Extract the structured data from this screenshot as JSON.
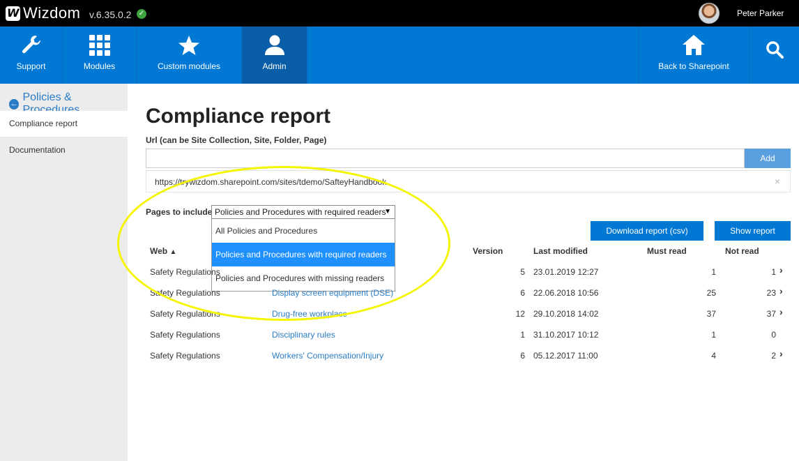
{
  "app": {
    "name": "Wizdom",
    "version": "v.6.35.0.2",
    "status_glyph": "✓"
  },
  "user": {
    "name": "Peter Parker"
  },
  "nav": {
    "items": [
      {
        "label": "Support",
        "icon": "wrench-icon"
      },
      {
        "label": "Modules",
        "icon": "grid-icon"
      },
      {
        "label": "Custom modules",
        "icon": "star-icon"
      },
      {
        "label": "Admin",
        "icon": "user-icon",
        "active": true
      }
    ],
    "back_label": "Back to Sharepoint",
    "search_icon": "search-icon"
  },
  "sidebar": {
    "heading": "Policies & Procedures",
    "items": [
      {
        "label": "Compliance report",
        "active": true
      },
      {
        "label": "Documentation"
      }
    ]
  },
  "main": {
    "title": "Compliance report",
    "url_label": "Url (can be Site Collection, Site, Folder, Page)",
    "url_value": "",
    "add_label": "Add",
    "url_entry": "https://trywizdom.sharepoint.com/sites/tdemo/SafteyHandbook",
    "remove_glyph": "×",
    "pages_label": "Pages to include",
    "select_value": "Policies and Procedures with required readers",
    "options": [
      "All Policies and Procedures",
      "Policies and Procedures with required readers",
      "Policies and Procedures with missing readers"
    ],
    "download_label": "Download report (csv)",
    "show_label": "Show report",
    "columns": {
      "web": "Web",
      "version": "Version",
      "last_modified": "Last modified",
      "must_read": "Must read",
      "not_read": "Not read"
    },
    "rows": [
      {
        "web": "Safety Regulations",
        "page": "",
        "version": "5",
        "modified": "23.01.2019 12:27",
        "must": "1",
        "not": "1",
        "chev": true
      },
      {
        "web": "Safety Regulations",
        "page": "Display screen equipment (DSE)",
        "version": "6",
        "modified": "22.06.2018 10:56",
        "must": "25",
        "not": "23",
        "chev": true
      },
      {
        "web": "Safety Regulations",
        "page": "Drug-free workplace",
        "version": "12",
        "modified": "29.10.2018 14:02",
        "must": "37",
        "not": "37",
        "chev": true
      },
      {
        "web": "Safety Regulations",
        "page": "Disciplinary rules",
        "version": "1",
        "modified": "31.10.2017 10:12",
        "must": "1",
        "not": "0",
        "chev": false
      },
      {
        "web": "Safety Regulations",
        "page": "Workers' Compensation/Injury",
        "version": "6",
        "modified": "05.12.2017 11:00",
        "must": "4",
        "not": "2",
        "chev": true
      }
    ]
  },
  "colors": {
    "nav_blue": "#0078d4",
    "link_blue": "#2a7cc7",
    "highlight": "#f5f500",
    "option_selected": "#1e90ff"
  }
}
